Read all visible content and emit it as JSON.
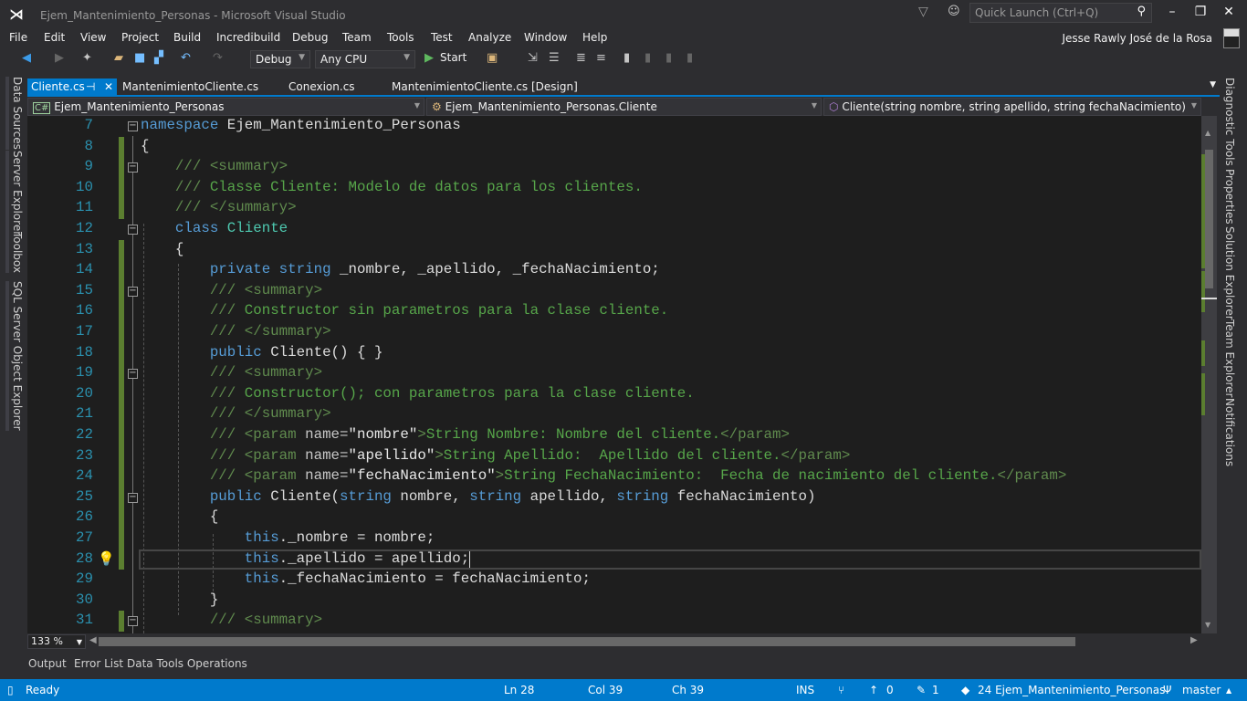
{
  "window": {
    "title": "Ejem_Mantenimiento_Personas - Microsoft Visual Studio",
    "quick_launch_placeholder": "Quick Launch (Ctrl+Q)",
    "user": "Jesse Rawly José de la Rosa"
  },
  "menu": [
    "File",
    "Edit",
    "View",
    "Project",
    "Build",
    "Incredibuild",
    "Debug",
    "Team",
    "Tools",
    "Test",
    "Analyze",
    "Window",
    "Help"
  ],
  "toolbar": {
    "config": "Debug",
    "platform": "Any CPU",
    "start": "Start"
  },
  "left_panels": [
    "Data Sources",
    "Server Explorer",
    "Toolbox",
    "SQL Server Object Explorer"
  ],
  "right_panels": [
    "Diagnostic Tools",
    "Properties",
    "Solution Explorer",
    "Team Explorer",
    "Notifications"
  ],
  "tabs": [
    {
      "label": "Cliente.cs",
      "active": true
    },
    {
      "label": "MantenimientoCliente.cs"
    },
    {
      "label": "Conexion.cs"
    },
    {
      "label": "MantenimientoCliente.cs [Design]"
    }
  ],
  "nav": {
    "project": "Ejem_Mantenimiento_Personas",
    "type": "Ejem_Mantenimiento_Personas.Cliente",
    "member": "Cliente(string nombre, string apellido, string fechaNacimiento)"
  },
  "editor": {
    "zoom": "133 %",
    "current_line": 28,
    "lines": [
      {
        "n": 7,
        "i": 0,
        "fold": true,
        "t": [
          [
            "kw",
            "namespace"
          ],
          [
            "pl",
            " Ejem_Mantenimiento_Personas"
          ]
        ]
      },
      {
        "n": 8,
        "i": 0,
        "chg": true,
        "t": [
          [
            "pl",
            "{"
          ]
        ]
      },
      {
        "n": 9,
        "i": 1,
        "chg": true,
        "fold": true,
        "t": [
          [
            "dt",
            "/// <summary>"
          ]
        ]
      },
      {
        "n": 10,
        "i": 1,
        "chg": true,
        "t": [
          [
            "dt",
            "/// "
          ],
          [
            "cm",
            "Classe Cliente: Modelo de datos para los clientes."
          ]
        ]
      },
      {
        "n": 11,
        "i": 1,
        "chg": true,
        "t": [
          [
            "dt",
            "/// </summary>"
          ]
        ]
      },
      {
        "n": 12,
        "i": 1,
        "fold": true,
        "t": [
          [
            "kw",
            "class "
          ],
          [
            "ty",
            "Cliente"
          ]
        ]
      },
      {
        "n": 13,
        "i": 1,
        "chg": true,
        "t": [
          [
            "pl",
            "{"
          ]
        ]
      },
      {
        "n": 14,
        "i": 2,
        "chg": true,
        "t": [
          [
            "kw",
            "private string "
          ],
          [
            "pl",
            "_nombre, _apellido, _fechaNacimiento;"
          ]
        ]
      },
      {
        "n": 15,
        "i": 2,
        "chg": true,
        "fold": true,
        "t": [
          [
            "dt",
            "/// <summary>"
          ]
        ]
      },
      {
        "n": 16,
        "i": 2,
        "chg": true,
        "t": [
          [
            "dt",
            "/// "
          ],
          [
            "cm",
            "Constructor sin parametros para la clase cliente."
          ]
        ]
      },
      {
        "n": 17,
        "i": 2,
        "chg": true,
        "t": [
          [
            "dt",
            "/// </summary>"
          ]
        ]
      },
      {
        "n": 18,
        "i": 2,
        "chg": true,
        "t": [
          [
            "kw",
            "public "
          ],
          [
            "pl",
            "Cliente() { }"
          ]
        ]
      },
      {
        "n": 19,
        "i": 2,
        "chg": true,
        "fold": true,
        "t": [
          [
            "dt",
            "/// <summary>"
          ]
        ]
      },
      {
        "n": 20,
        "i": 2,
        "chg": true,
        "t": [
          [
            "dt",
            "/// "
          ],
          [
            "cm",
            "Constructor(); con parametros para la clase cliente."
          ]
        ]
      },
      {
        "n": 21,
        "i": 2,
        "chg": true,
        "t": [
          [
            "dt",
            "/// </summary>"
          ]
        ]
      },
      {
        "n": 22,
        "i": 2,
        "chg": true,
        "t": [
          [
            "dt",
            "/// <param "
          ],
          [
            "dn",
            "name="
          ],
          [
            "ds",
            "\"nombre\""
          ],
          [
            "dt",
            ">"
          ],
          [
            "cm",
            "String Nombre: Nombre del cliente."
          ],
          [
            "dt",
            "</param>"
          ]
        ]
      },
      {
        "n": 23,
        "i": 2,
        "chg": true,
        "t": [
          [
            "dt",
            "/// <param "
          ],
          [
            "dn",
            "name="
          ],
          [
            "ds",
            "\"apellido\""
          ],
          [
            "dt",
            ">"
          ],
          [
            "cm",
            "String Apellido:  Apellido del cliente."
          ],
          [
            "dt",
            "</param>"
          ]
        ]
      },
      {
        "n": 24,
        "i": 2,
        "chg": true,
        "t": [
          [
            "dt",
            "/// <param "
          ],
          [
            "dn",
            "name="
          ],
          [
            "ds",
            "\"fechaNacimiento\""
          ],
          [
            "dt",
            ">"
          ],
          [
            "cm",
            "String FechaNacimiento:  Fecha de nacimiento del cliente."
          ],
          [
            "dt",
            "</param>"
          ]
        ]
      },
      {
        "n": 25,
        "i": 2,
        "chg": true,
        "fold": true,
        "t": [
          [
            "kw",
            "public "
          ],
          [
            "pl",
            "Cliente("
          ],
          [
            "kw",
            "string "
          ],
          [
            "pl",
            "nombre, "
          ],
          [
            "kw",
            "string "
          ],
          [
            "pl",
            "apellido, "
          ],
          [
            "kw",
            "string "
          ],
          [
            "pl",
            "fechaNacimiento)"
          ]
        ]
      },
      {
        "n": 26,
        "i": 2,
        "chg": true,
        "t": [
          [
            "pl",
            "{"
          ]
        ]
      },
      {
        "n": 27,
        "i": 3,
        "chg": true,
        "t": [
          [
            "kw",
            "this"
          ],
          [
            "pl",
            "._nombre = nombre;"
          ]
        ]
      },
      {
        "n": 28,
        "i": 3,
        "chg": true,
        "t": [
          [
            "kw",
            "this"
          ],
          [
            "pl",
            "._apellido = apellido;"
          ]
        ]
      },
      {
        "n": 29,
        "i": 3,
        "t": [
          [
            "kw",
            "this"
          ],
          [
            "pl",
            "._fechaNacimiento = fechaNacimiento;"
          ]
        ]
      },
      {
        "n": 30,
        "i": 2,
        "t": [
          [
            "pl",
            "}"
          ]
        ]
      },
      {
        "n": 31,
        "i": 2,
        "chg": true,
        "fold": true,
        "t": [
          [
            "dt",
            "/// <summary>"
          ]
        ]
      }
    ]
  },
  "bottom_tabs": [
    "Output",
    "Error List",
    "Data Tools Operations"
  ],
  "status": {
    "state": "Ready",
    "ln": "Ln 28",
    "col": "Col 39",
    "ch": "Ch 39",
    "mode": "INS",
    "up": "0",
    "pencil": "1",
    "repo": "24 Ejem_Mantenimiento_Personas",
    "branch": "master"
  },
  "colors": {
    "accent": "#007acc",
    "keyword": "#569cd6",
    "type": "#4ec9b0",
    "comment": "#57a64a",
    "line_number": "#2b91af"
  }
}
